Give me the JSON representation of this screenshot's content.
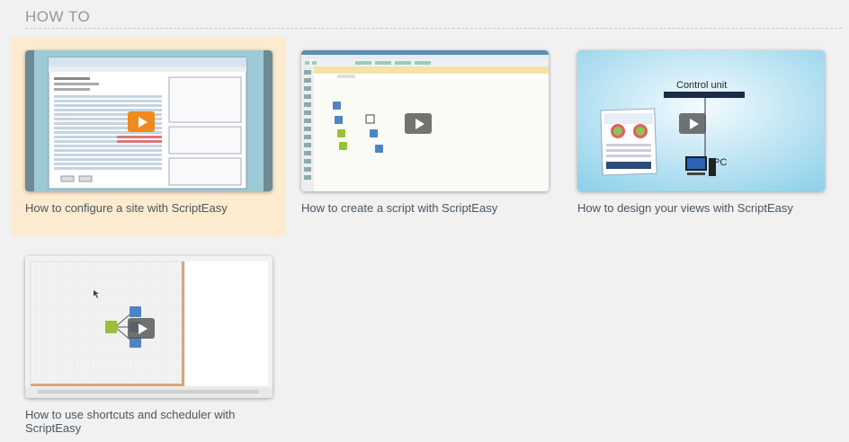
{
  "section": {
    "title": "HOW TO"
  },
  "videos": [
    {
      "caption": "How to configure a site with ScriptEasy",
      "highlighted": true
    },
    {
      "caption": "How to create a script with ScriptEasy"
    },
    {
      "caption": "How to design your views with ScriptEasy",
      "diagram": {
        "unit_label": "Control unit",
        "pc_label": "PC"
      }
    },
    {
      "caption": "How to use shortcuts and scheduler with ScriptEasy"
    }
  ],
  "colors": {
    "accent": "#ef8a1c",
    "highlight": "#fcebcf",
    "title": "#8e9aa3"
  }
}
